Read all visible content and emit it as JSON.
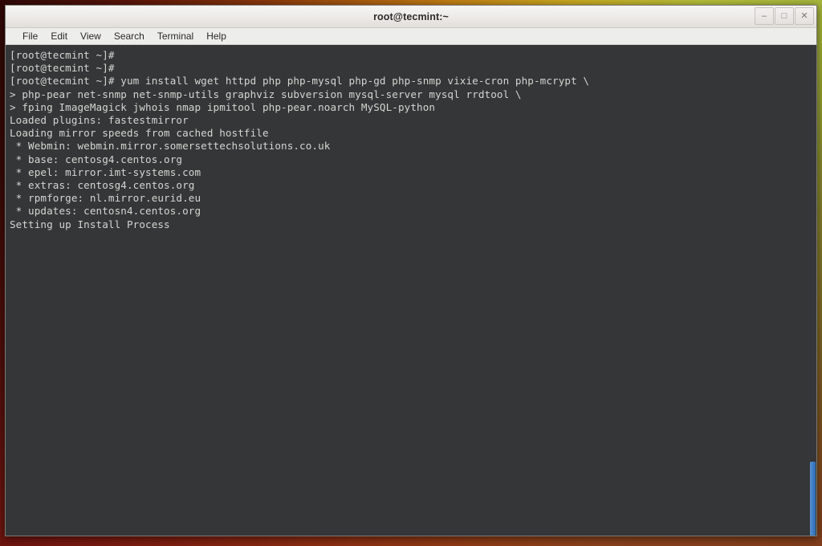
{
  "window": {
    "title": "root@tecmint:~",
    "controls": [
      {
        "name": "minimize-button",
        "glyph": "–"
      },
      {
        "name": "maximize-button",
        "glyph": "□"
      },
      {
        "name": "close-button",
        "glyph": "✕"
      }
    ]
  },
  "menu": {
    "items": [
      {
        "label": "File"
      },
      {
        "label": "Edit"
      },
      {
        "label": "View"
      },
      {
        "label": "Search"
      },
      {
        "label": "Terminal"
      },
      {
        "label": "Help"
      }
    ]
  },
  "terminal": {
    "prompt": "[root@tecmint ~]#",
    "continuation_prompt": ">",
    "background_color": "#343638",
    "text_color": "#d6d5d1",
    "lines": [
      "[root@tecmint ~]#",
      "[root@tecmint ~]#",
      "[root@tecmint ~]# yum install wget httpd php php-mysql php-gd php-snmp vixie-cron php-mcrypt \\",
      "> php-pear net-snmp net-snmp-utils graphviz subversion mysql-server mysql rrdtool \\",
      "> fping ImageMagick jwhois nmap ipmitool php-pear.noarch MySQL-python",
      "Loaded plugins: fastestmirror",
      "Loading mirror speeds from cached hostfile",
      " * Webmin: webmin.mirror.somersettechsolutions.co.uk",
      " * base: centosg4.centos.org",
      " * epel: mirror.imt-systems.com",
      " * extras: centosg4.centos.org",
      " * rpmforge: nl.mirror.eurid.eu",
      " * updates: centosn4.centos.org",
      "Setting up Install Process"
    ]
  },
  "desktop": {
    "wallpaper_colors": [
      "#2e0806",
      "#8d3a0b",
      "#c07a14",
      "#b6bf3a",
      "#9aae35"
    ]
  },
  "scrollbar": {
    "thumb_color": "#3f7cc4"
  }
}
